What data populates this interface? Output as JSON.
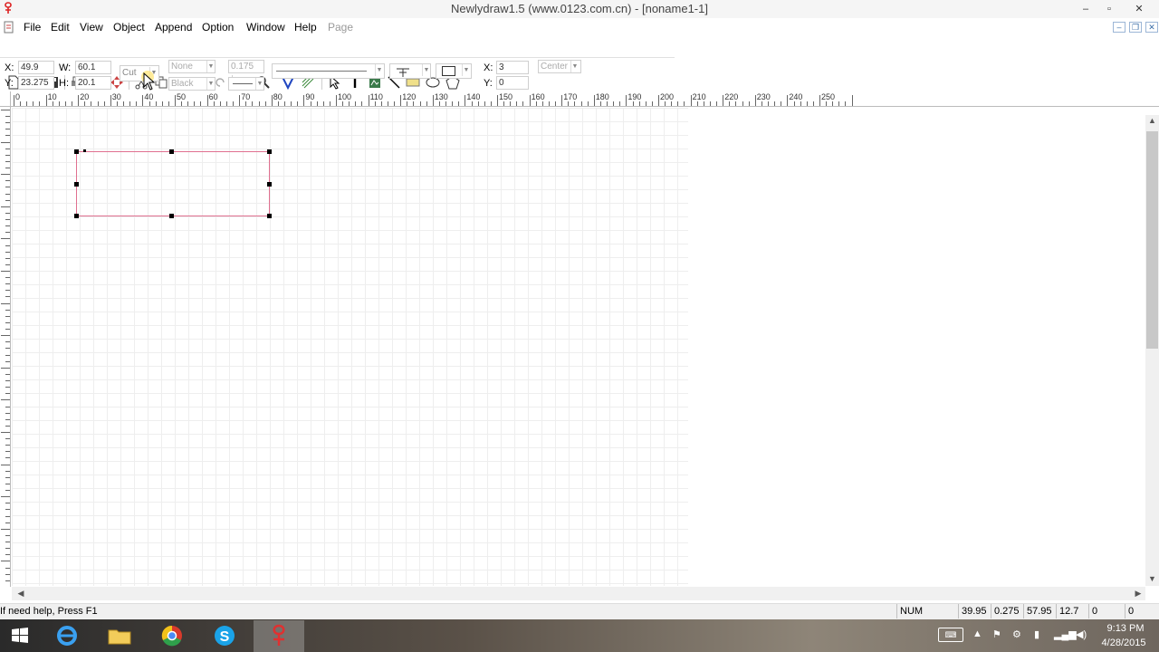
{
  "window": {
    "title": "Newlydraw1.5 (www.0123.com.cn) - [noname1-1]",
    "minimize": "–",
    "maximize": "▫",
    "close": "✕"
  },
  "menu": {
    "items": [
      "File",
      "Edit",
      "View",
      "Object",
      "Append",
      "Option",
      "Window",
      "Help",
      "Page"
    ]
  },
  "propbar": {
    "x_label": "X:",
    "x_value": "49.9",
    "y_label": "Y:",
    "y_value": "23.275",
    "w_label": "W:",
    "w_value": "60.1",
    "h_label": "H:",
    "h_value": "20.1",
    "mode_value": "Cut",
    "fill_value": "None",
    "color_value": "Black",
    "line_width": "0.175",
    "offset_x_label": "X:",
    "offset_x_value": "3",
    "offset_y_label": "Y:",
    "offset_y_value": "0",
    "align_value": "Center"
  },
  "ruler": {
    "h_labels": [
      "0",
      "10",
      "20",
      "30",
      "40",
      "50",
      "60",
      "70",
      "80",
      "90",
      "100",
      "110",
      "120",
      "130",
      "140",
      "150",
      "160",
      "170",
      "180",
      "190",
      "200",
      "210",
      "220",
      "230",
      "240",
      "250"
    ]
  },
  "statusbar": {
    "help_text": "If need help, Press F1",
    "num": "NUM",
    "c1": "39.95",
    "c2": "0.275",
    "c3": "57.95",
    "c4": "12.7",
    "c5": "0",
    "c6": "0"
  },
  "taskbar": {
    "time": "9:13 PM",
    "date": "4/28/2015"
  },
  "colors": {
    "selection_outline": "#e07090",
    "title_bar": "#f5f5f5"
  }
}
